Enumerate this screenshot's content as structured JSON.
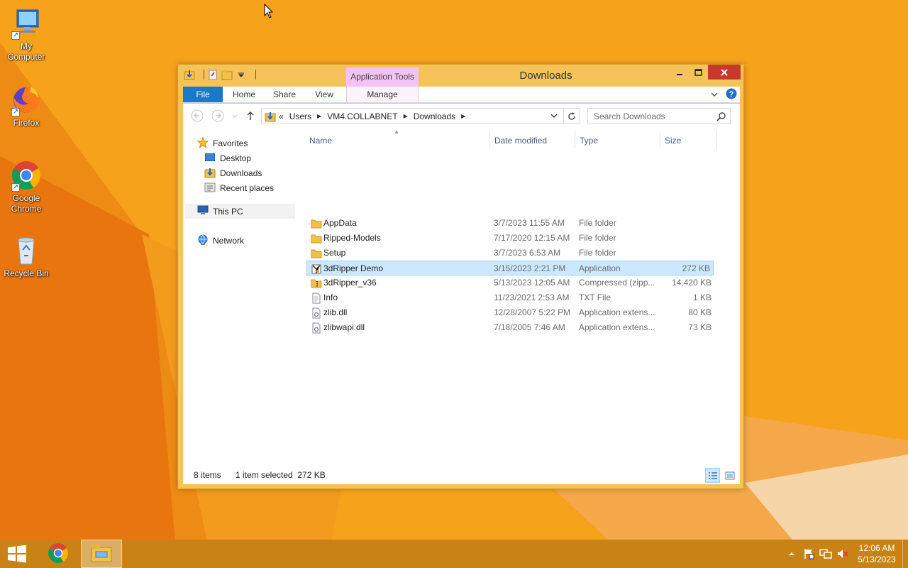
{
  "desktop": {
    "icons": [
      {
        "label_line1": "My",
        "label_line2": "Computer",
        "icon": "my-computer-icon"
      },
      {
        "label_line1": "Firefox",
        "label_line2": "",
        "icon": "firefox-icon"
      },
      {
        "label_line1": "Google",
        "label_line2": "Chrome",
        "icon": "chrome-icon"
      },
      {
        "label_line1": "Recycle Bin",
        "label_line2": "",
        "icon": "recycle-bin-icon"
      }
    ]
  },
  "window": {
    "title": "Downloads",
    "contextual_tab_group": "Application Tools",
    "ribbon_tabs": [
      "File",
      "Home",
      "Share",
      "View",
      "Manage"
    ],
    "address": {
      "crumbs": [
        "Users",
        "VM4.COLLABNET",
        "Downloads"
      ],
      "overflow": "«"
    },
    "search": {
      "placeholder": "Search Downloads"
    }
  },
  "nav_pane": {
    "favorites_label": "Favorites",
    "favorites": [
      "Desktop",
      "Downloads",
      "Recent places"
    ],
    "this_pc": "This PC",
    "network": "Network"
  },
  "file_list": {
    "columns": {
      "name": "Name",
      "date": "Date modified",
      "type": "Type",
      "size": "Size"
    },
    "rows": [
      {
        "name": "AppData",
        "date": "3/7/2023 11:55 AM",
        "type": "File folder",
        "size": "",
        "icon": "folder-icon"
      },
      {
        "name": "Ripped-Models",
        "date": "7/17/2020 12:15 AM",
        "type": "File folder",
        "size": "",
        "icon": "folder-icon"
      },
      {
        "name": "Setup",
        "date": "3/7/2023 6:53 AM",
        "type": "File folder",
        "size": "",
        "icon": "folder-icon"
      },
      {
        "name": "3dRipper Demo",
        "date": "3/15/2023 2:21 PM",
        "type": "Application",
        "size": "272 KB",
        "icon": "application-icon",
        "selected": true
      },
      {
        "name": "3dRipper_v36",
        "date": "5/13/2023 12:05 AM",
        "type": "Compressed (zipp...",
        "size": "14,420 KB",
        "icon": "zip-folder-icon"
      },
      {
        "name": "Info",
        "date": "11/23/2021 2:53 AM",
        "type": "TXT File",
        "size": "1 KB",
        "icon": "text-file-icon"
      },
      {
        "name": "zlib.dll",
        "date": "12/28/2007 5:22 PM",
        "type": "Application extens...",
        "size": "80 KB",
        "icon": "dll-file-icon"
      },
      {
        "name": "zlibwapi.dll",
        "date": "7/18/2005 7:46 AM",
        "type": "Application extens...",
        "size": "73 KB",
        "icon": "dll-file-icon"
      }
    ]
  },
  "status": {
    "item_count": "8 items",
    "selection": "1 item selected  272 KB"
  },
  "taskbar": {
    "time": "12:06 AM",
    "date": "5/13/2023"
  },
  "colors": {
    "desktop_bg": "#f7a21b",
    "window_frame": "#f6c35a",
    "file_tab": "#1979ca",
    "app_tools": "#f2c4f4",
    "selection": "#cce8ff",
    "close_button": "#c7392b"
  }
}
